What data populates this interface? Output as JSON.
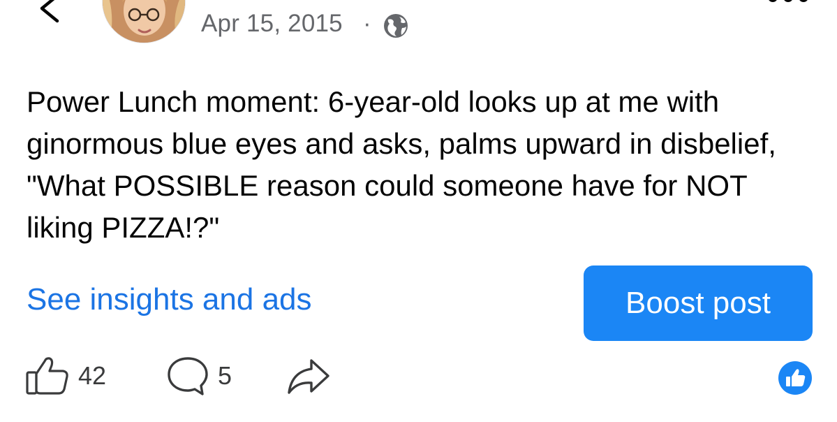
{
  "header": {
    "back_icon": "chevron-left-icon",
    "date": "Apr 15, 2015",
    "separator": "·",
    "privacy_icon": "globe-icon",
    "more_icon": "more-dots-icon"
  },
  "post": {
    "text": "Power Lunch moment: 6-year-old looks up at me with ginormous blue eyes and asks, palms upward in disbelief, \"What POSSIBLE reason could someone have for NOT liking PIZZA!?\""
  },
  "promo": {
    "insights_label": "See insights and ads",
    "boost_label": "Boost post"
  },
  "actions": {
    "like_count": "42",
    "comment_count": "5",
    "like_icon": "thumbs-up-icon",
    "comment_icon": "comment-bubble-icon",
    "share_icon": "share-arrow-icon",
    "reaction_icon": "like-reaction-icon"
  },
  "colors": {
    "accent": "#1b74e4",
    "button": "#1b86f5",
    "secondary_text": "#65676b"
  }
}
